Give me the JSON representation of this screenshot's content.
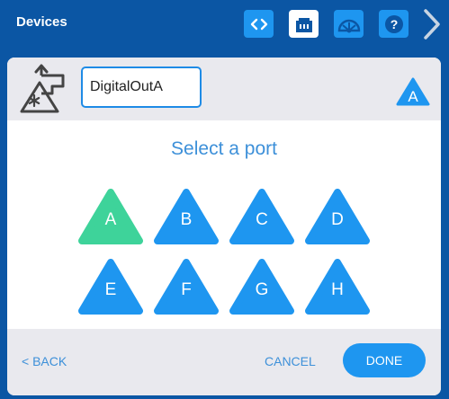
{
  "topbar": {
    "title": "Devices",
    "buttons": [
      {
        "icon": "code-brackets-icon"
      },
      {
        "icon": "devices-port-icon",
        "active": true
      },
      {
        "icon": "dashboard-gauge-icon"
      },
      {
        "icon": "help-question-icon"
      }
    ],
    "next_icon": "chevron-right-icon"
  },
  "device": {
    "icon": "digital-out-device-icon",
    "name_value": "DigitalOutA",
    "selected_port": "A"
  },
  "selector": {
    "prompt": "Select a port",
    "ports": [
      {
        "label": "A",
        "selected": true
      },
      {
        "label": "B",
        "selected": false
      },
      {
        "label": "C",
        "selected": false
      },
      {
        "label": "D",
        "selected": false
      },
      {
        "label": "E",
        "selected": false
      },
      {
        "label": "F",
        "selected": false
      },
      {
        "label": "G",
        "selected": false
      },
      {
        "label": "H",
        "selected": false
      }
    ]
  },
  "footer": {
    "back_label": "< BACK",
    "cancel_label": "CANCEL",
    "done_label": "DONE"
  },
  "colors": {
    "background": "#0b56a4",
    "accent": "#1e96f0",
    "selected_port": "#3ed39a",
    "text_accent": "#3d90d9"
  }
}
